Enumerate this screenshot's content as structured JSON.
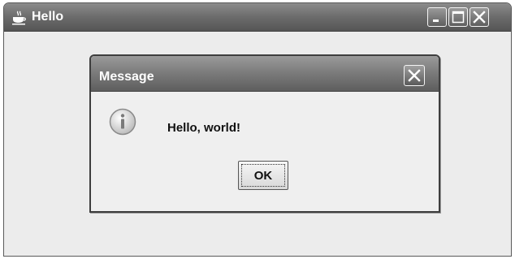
{
  "main_window": {
    "title": "Hello",
    "icon": "java-coffee-cup-icon",
    "controls": [
      "minimize-icon",
      "maximize-icon",
      "close-icon"
    ]
  },
  "dialog": {
    "title": "Message",
    "icon": "information-icon",
    "message": "Hello, world!",
    "ok_label": "OK",
    "close_icon": "close-icon"
  }
}
